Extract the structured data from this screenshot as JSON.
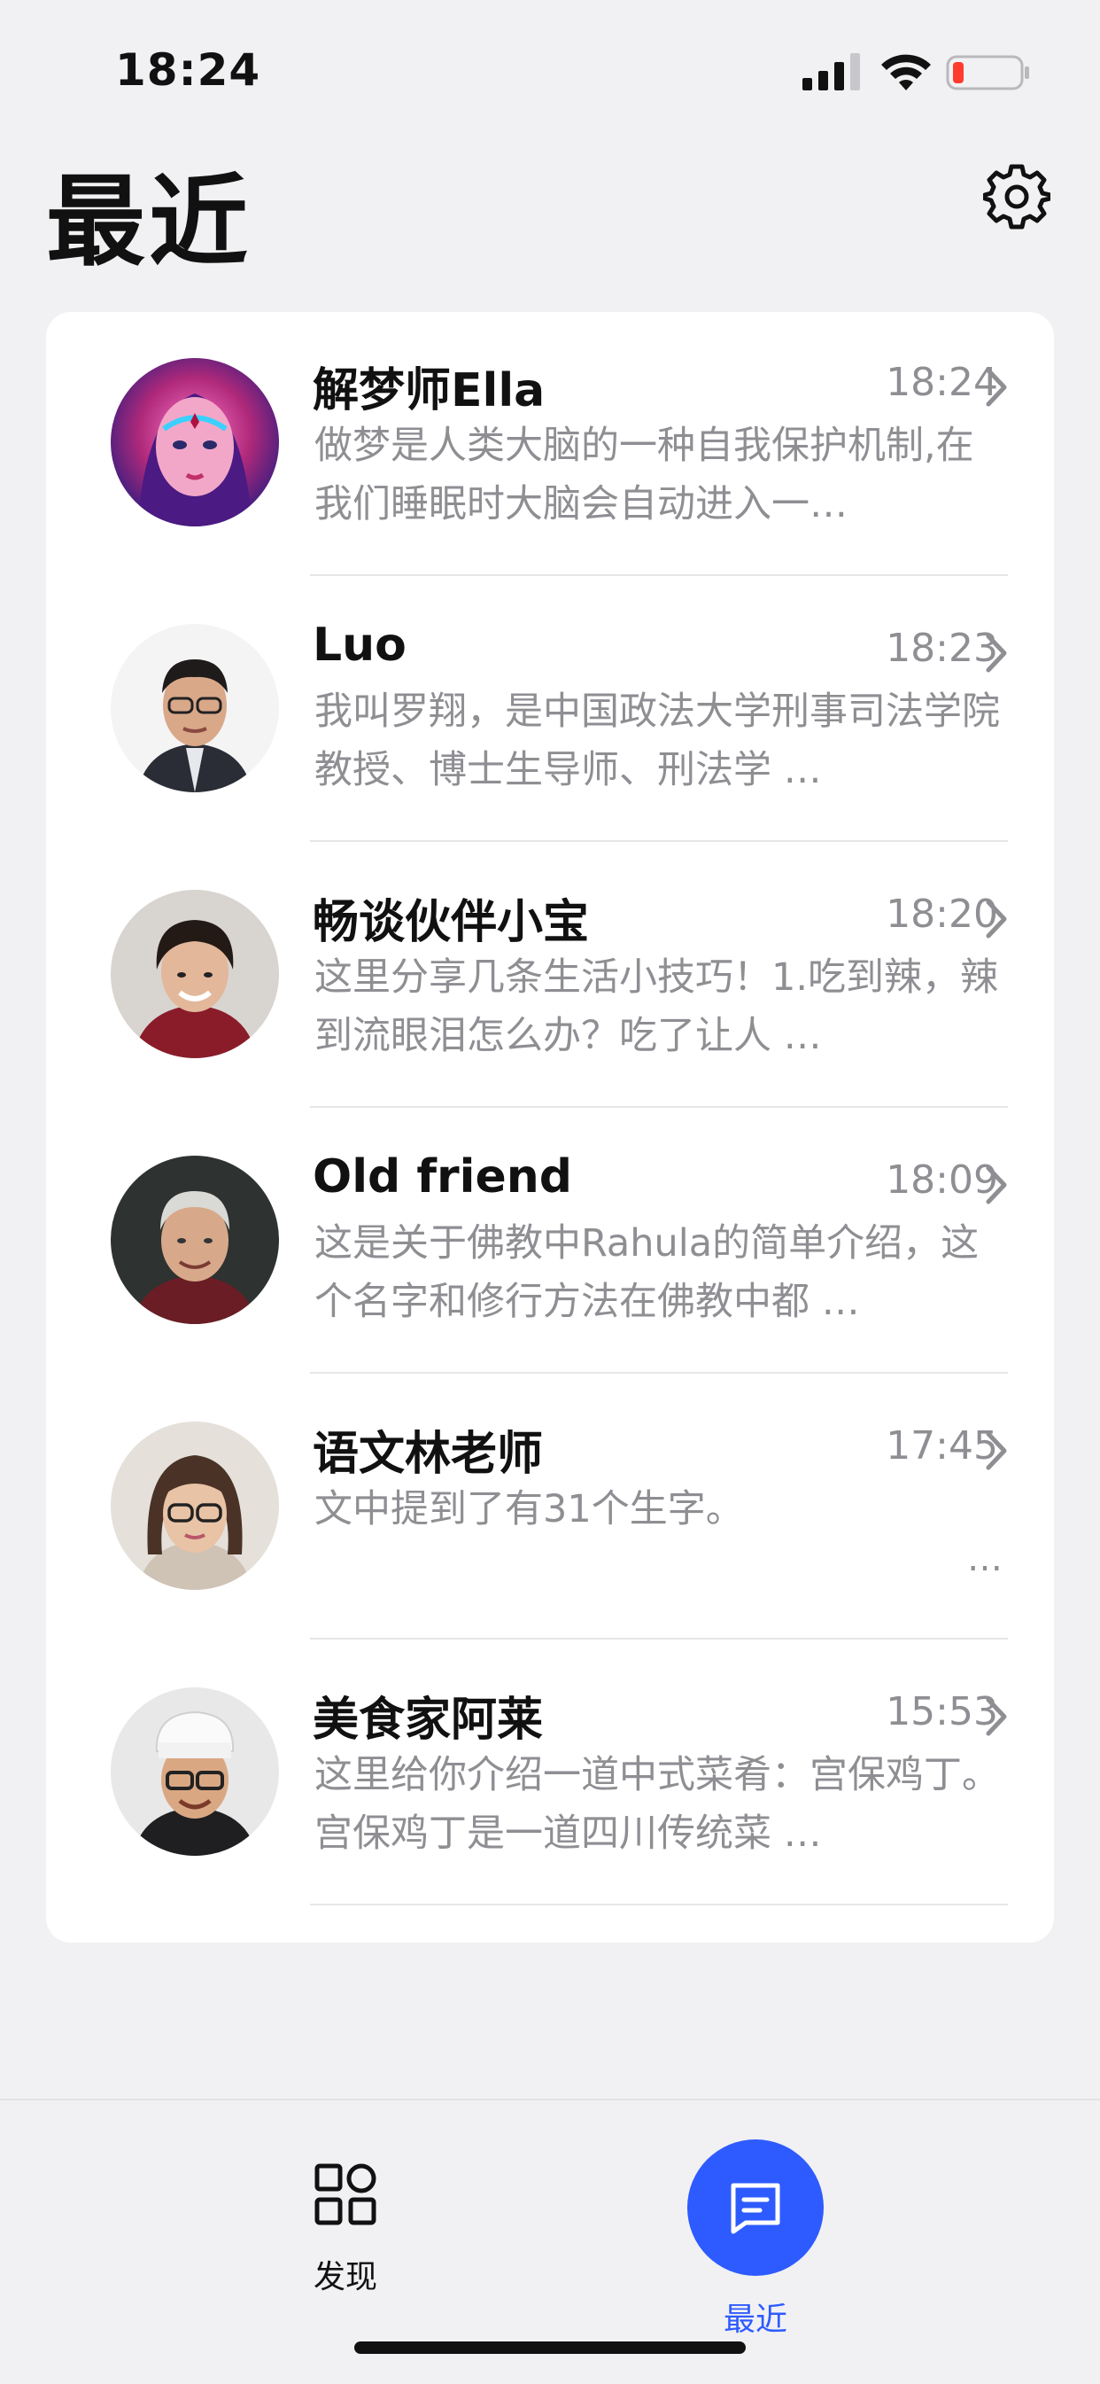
{
  "status": {
    "time": "18:24"
  },
  "header": {
    "title": "最近",
    "settings_icon": "gear-icon"
  },
  "chats": [
    {
      "name": "解梦师Ella",
      "time": "18:24",
      "preview": "做梦是人类大脑的一种自我保护机制,在我们睡眠时大脑会自动进入一…",
      "avatar": "fantasy-woman-portrait"
    },
    {
      "name": "Luo",
      "time": "18:23",
      "preview": "我叫罗翔，是中国政法大学刑事司法学院教授、博士生导师、刑法学 …",
      "avatar": "man-with-glasses-portrait"
    },
    {
      "name": "畅谈伙伴小宝",
      "time": "18:20",
      "preview": "这里分享几条生活小技巧！1.吃到辣，辣到流眼泪怎么办？吃了让人 …",
      "avatar": "young-man-portrait"
    },
    {
      "name": "Old friend",
      "time": "18:09",
      "preview": "这是关于佛教中Rahula的简单介绍，这个名字和修行方法在佛教中都 …",
      "avatar": "older-man-portrait"
    },
    {
      "name": "语文林老师",
      "time": "17:45",
      "preview": "文中提到了有31个生字。",
      "more": "…",
      "avatar": "woman-with-glasses-portrait"
    },
    {
      "name": "美食家阿莱",
      "time": "15:53",
      "preview": "这里给你介绍一道中式菜肴：宫保鸡丁。宫保鸡丁是一道四川传统菜 …",
      "avatar": "chef-portrait"
    }
  ],
  "tabbar": {
    "discover": {
      "label": "发现",
      "icon": "grid-icon"
    },
    "recent": {
      "label": "最近",
      "icon": "chat-icon",
      "color": "#2e5bff"
    }
  },
  "colors": {
    "accent": "#2e5bff",
    "battery_low": "#ff3b30"
  }
}
